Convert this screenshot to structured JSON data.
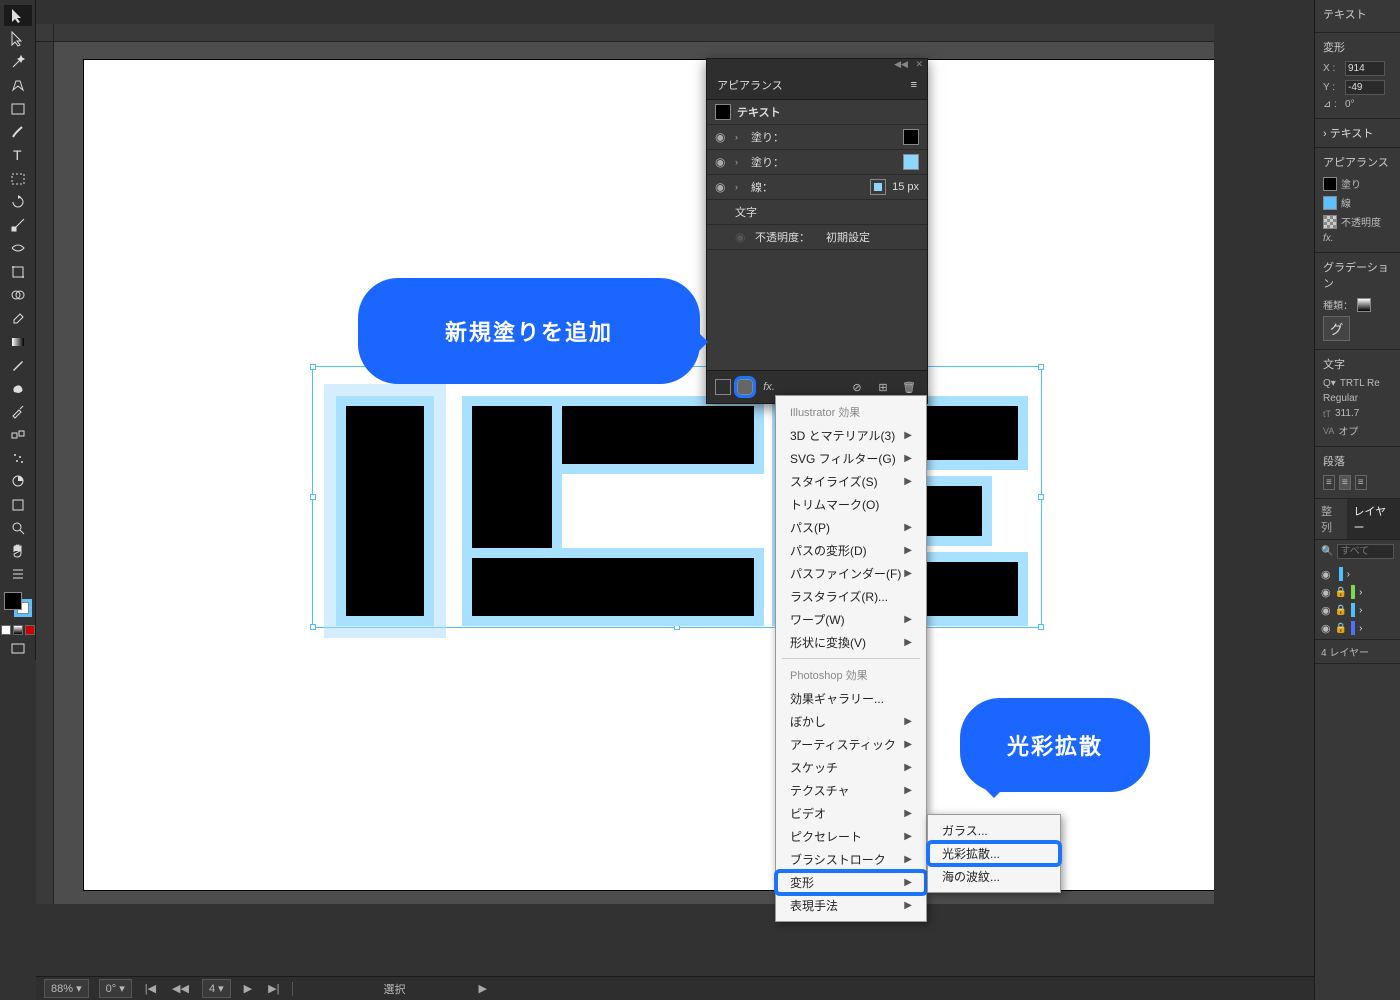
{
  "toolbar": {
    "tools": [
      "selection",
      "direct-select",
      "pen",
      "curvature",
      "rectangle",
      "line",
      "type",
      "area-type",
      "scale",
      "free-transform",
      "shape-builder",
      "width",
      "paintbrush",
      "blob-brush",
      "pencil",
      "eraser",
      "rotate",
      "scissors",
      "eyedropper",
      "gradient",
      "mesh",
      "perspective",
      "symbol-sprayer",
      "column-graph",
      "artboard",
      "slice",
      "hand",
      "zoom"
    ]
  },
  "canvas": {
    "artwork_text": "ICE"
  },
  "appearance_panel": {
    "title": "アピアランス",
    "object_label": "テキスト",
    "rows": [
      {
        "label": "塗り：",
        "swatch": "#000000"
      },
      {
        "label": "塗り：",
        "swatch": "#8fd6ff"
      },
      {
        "label": "線：",
        "swatch": "#8fd6ff",
        "value": "15 px"
      },
      {
        "label": "文字",
        "swatch": null
      },
      {
        "label": "不透明度：",
        "value": "初期設定"
      }
    ],
    "footer_buttons": [
      "new-stroke",
      "new-fill",
      "fx",
      "clear",
      "duplicate",
      "delete"
    ]
  },
  "callouts": {
    "new_fill": "新規塗りを追加",
    "diffuse_glow": "光彩拡散"
  },
  "fx_menu": {
    "heading1": "Illustrator 効果",
    "items1": [
      "3D とマテリアル(3)",
      "SVG フィルター(G)",
      "スタイライズ(S)",
      "トリムマーク(O)",
      "パス(P)",
      "パスの変形(D)",
      "パスファインダー(F)",
      "ラスタライズ(R)...",
      "ワープ(W)",
      "形状に変換(V)"
    ],
    "heading2": "Photoshop 効果",
    "items2": [
      "効果ギャラリー...",
      "ぼかし",
      "アーティスティック",
      "スケッチ",
      "テクスチャ",
      "ビデオ",
      "ピクセレート",
      "ブラシストローク",
      "変形",
      "表現手法"
    ],
    "items1_arrows": [
      true,
      true,
      true,
      false,
      true,
      true,
      true,
      false,
      true,
      true
    ],
    "items2_arrows": [
      false,
      true,
      true,
      true,
      true,
      true,
      true,
      true,
      true,
      true
    ],
    "highlighted_index": 8,
    "submenu": [
      "ガラス...",
      "光彩拡散...",
      "海の波紋..."
    ],
    "submenu_highlighted_index": 1
  },
  "right_panels": {
    "text_tab": "テキスト",
    "transform": {
      "title": "変形",
      "x_label": "X :",
      "x_value": "914",
      "y_label": "Y :",
      "y_value": "-49",
      "angle_label": "⊿ :",
      "angle_value": "0°"
    },
    "text_more": "テキスト",
    "appearance": {
      "title": "アピアランス",
      "fill": "塗り",
      "stroke": "線",
      "opacity": "不透明度",
      "fx": "fx."
    },
    "gradient": {
      "title": "グラデーション",
      "type_label": "種類：",
      "button": "グ"
    },
    "character": {
      "title": "文字",
      "font": "TRTL Re",
      "style": "Regular",
      "size": "311.7",
      "kerning": "オプ"
    },
    "paragraph": {
      "title": "段落"
    },
    "align_tab": "整列",
    "layers_tab": "レイヤー",
    "search_placeholder": "すべて",
    "layer_count": "4 レイヤー"
  },
  "statusbar": {
    "zoom": "88%",
    "rotation": "0°",
    "artboard_nav": "4",
    "mode": "選択"
  }
}
